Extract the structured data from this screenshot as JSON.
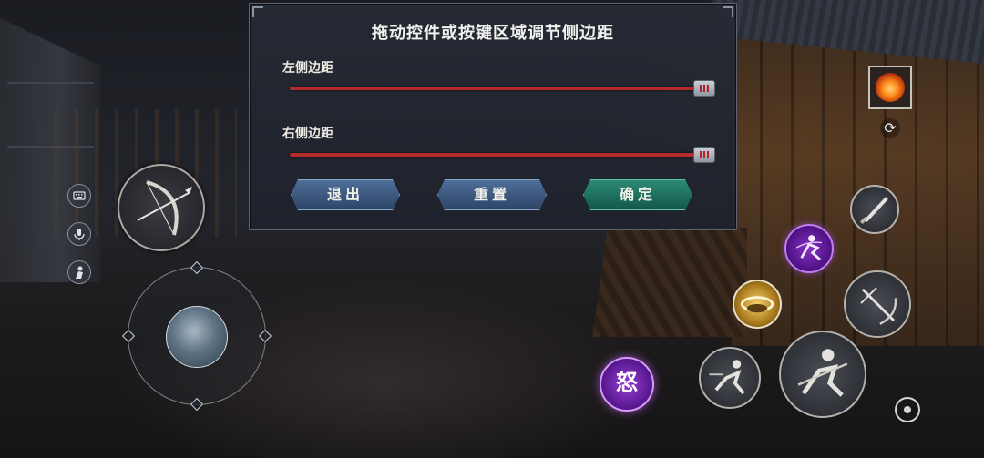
{
  "dialog": {
    "title": "拖动控件或按键区域调节侧边距",
    "left_margin": {
      "label": "左侧边距",
      "value_pct": 100
    },
    "right_margin": {
      "label": "右侧边距",
      "value_pct": 100
    },
    "buttons": {
      "exit": "退出",
      "reset": "重置",
      "confirm": "确定"
    }
  },
  "hud": {
    "left_icons": [
      "keyboard-icon",
      "voice-icon",
      "emote-icon"
    ],
    "rage_skill_label": "怒",
    "item_slot_icon": "fire-orb-icon",
    "colors": {
      "slider_track": "#b52a2a",
      "confirm_green": "#2c8a74",
      "button_blue": "#3f5c85",
      "purple_skill": "#8a2fc6"
    }
  }
}
